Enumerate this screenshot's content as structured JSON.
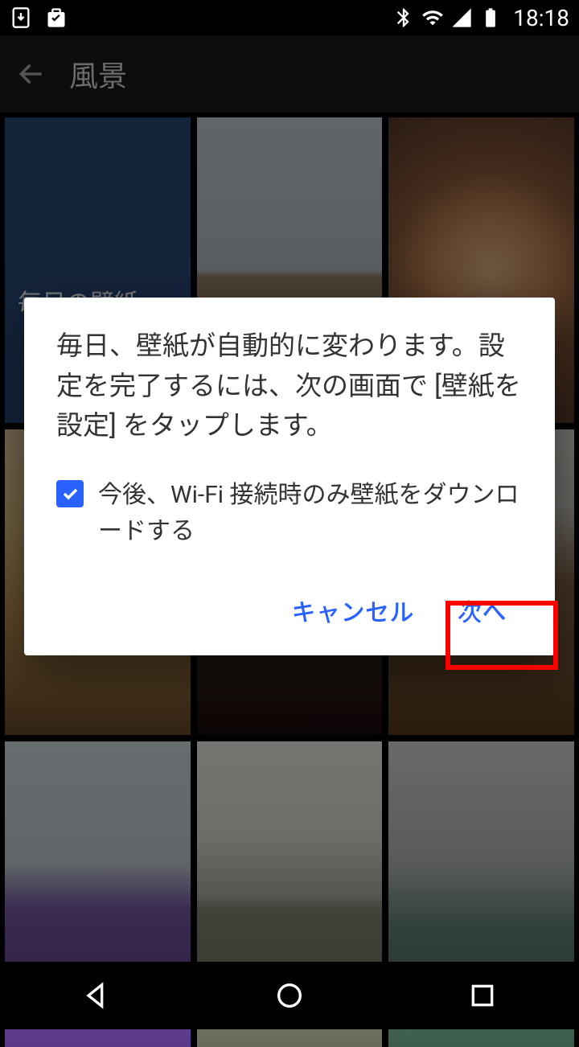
{
  "status_bar": {
    "time": "18:18"
  },
  "app_bar": {
    "title": "風景"
  },
  "wallpapers": [
    {
      "label": "毎日の壁紙"
    }
  ],
  "dialog": {
    "message": "毎日、壁紙が自動的に変わります。設定を完了するには、次の画面で [壁紙を設定] をタップします。",
    "checkbox_label": "今後、Wi-Fi 接続時のみ壁紙をダウンロードする",
    "checked": true,
    "cancel_label": "キャンセル",
    "next_label": "次へ"
  },
  "colors": {
    "accent": "#2962ff",
    "highlight": "#ff0000"
  }
}
